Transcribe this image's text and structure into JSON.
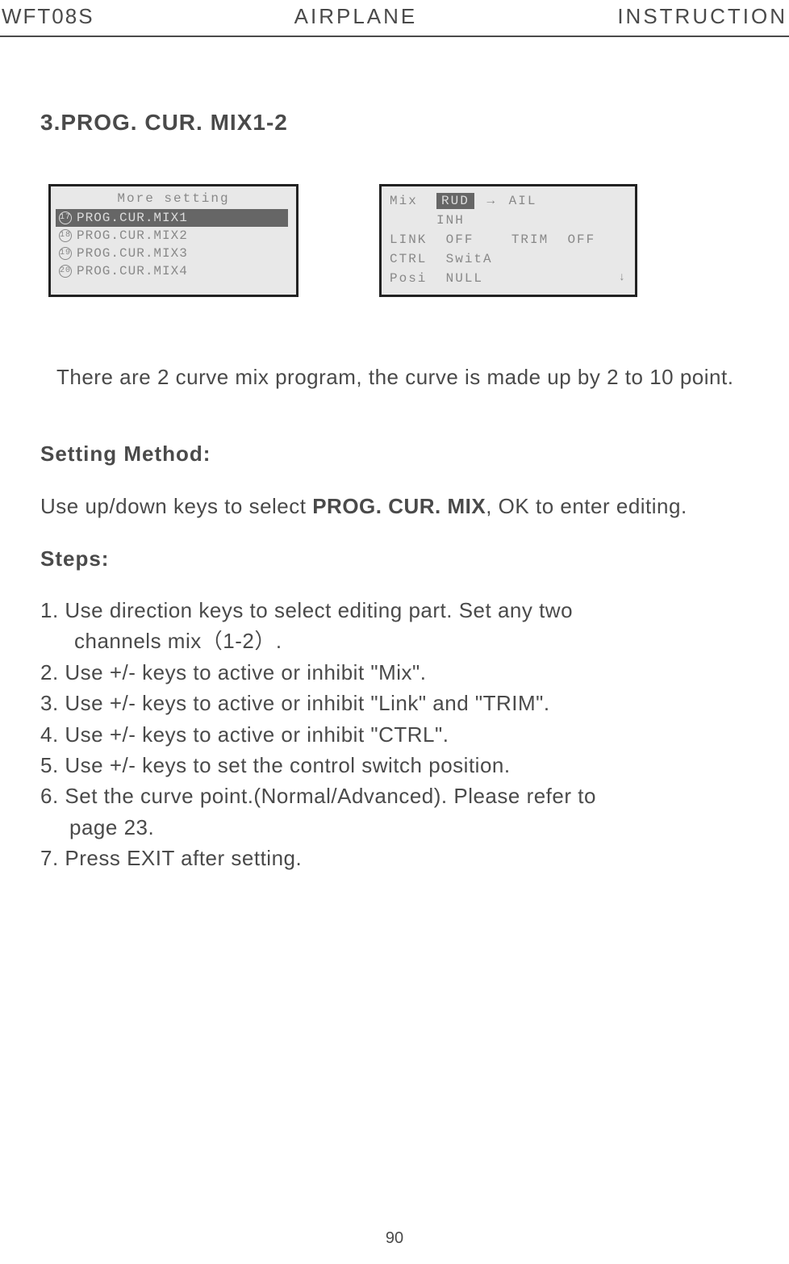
{
  "header": {
    "left": "WFT08S",
    "center": "AIRPLANE",
    "right": "INSTRUCTION"
  },
  "sectionTitle": "3.PROG. CUR. MIX1-2",
  "lcd1": {
    "title": "More setting",
    "items": [
      {
        "num": "17",
        "label": "PROG.CUR.MIX1",
        "selected": true
      },
      {
        "num": "18",
        "label": "PROG.CUR.MIX2",
        "selected": false
      },
      {
        "num": "19",
        "label": "PROG.CUR.MIX3",
        "selected": false
      },
      {
        "num": "20",
        "label": "PROG.CUR.MIX4",
        "selected": false
      }
    ]
  },
  "lcd2": {
    "line1_label": "Mix",
    "line1_highlight": "RUD",
    "line1_arrow": "→",
    "line1_target": "AIL",
    "line2_indent": "INH",
    "line3_link": "LINK",
    "line3_link_val": "OFF",
    "line3_trim": "TRIM",
    "line3_trim_val": "OFF",
    "line4_ctrl": "CTRL",
    "line4_ctrl_val": "SwitA",
    "line5_posi": "Posi",
    "line5_posi_val": "NULL"
  },
  "description": "There are 2 curve mix program, the curve is made up by 2 to 10 point.",
  "settingMethodTitle": "Setting Method:",
  "settingMethodText1": "Use up/down keys to select ",
  "settingMethodBold": "PROG. CUR. MIX",
  "settingMethodText2": ", OK to enter editing.",
  "stepsTitle": "Steps:",
  "steps": {
    "s1a": "1. Use direction keys to select editing part. Set any two",
    "s1b": "channels mix（1-2）.",
    "s2": "2. Use +/- keys to active or inhibit \"Mix\".",
    "s3": "3. Use +/- keys to active or inhibit \"Link\" and \"TRIM\".",
    "s4": "4. Use +/- keys to active or inhibit  \"CTRL\".",
    "s5": "5. Use +/- keys to set the control switch position.",
    "s6a": "6. Set the curve point.(Normal/Advanced). Please refer to",
    "s6b": "page 23.",
    "s7": "7. Press EXIT after setting."
  },
  "pageNumber": "90"
}
